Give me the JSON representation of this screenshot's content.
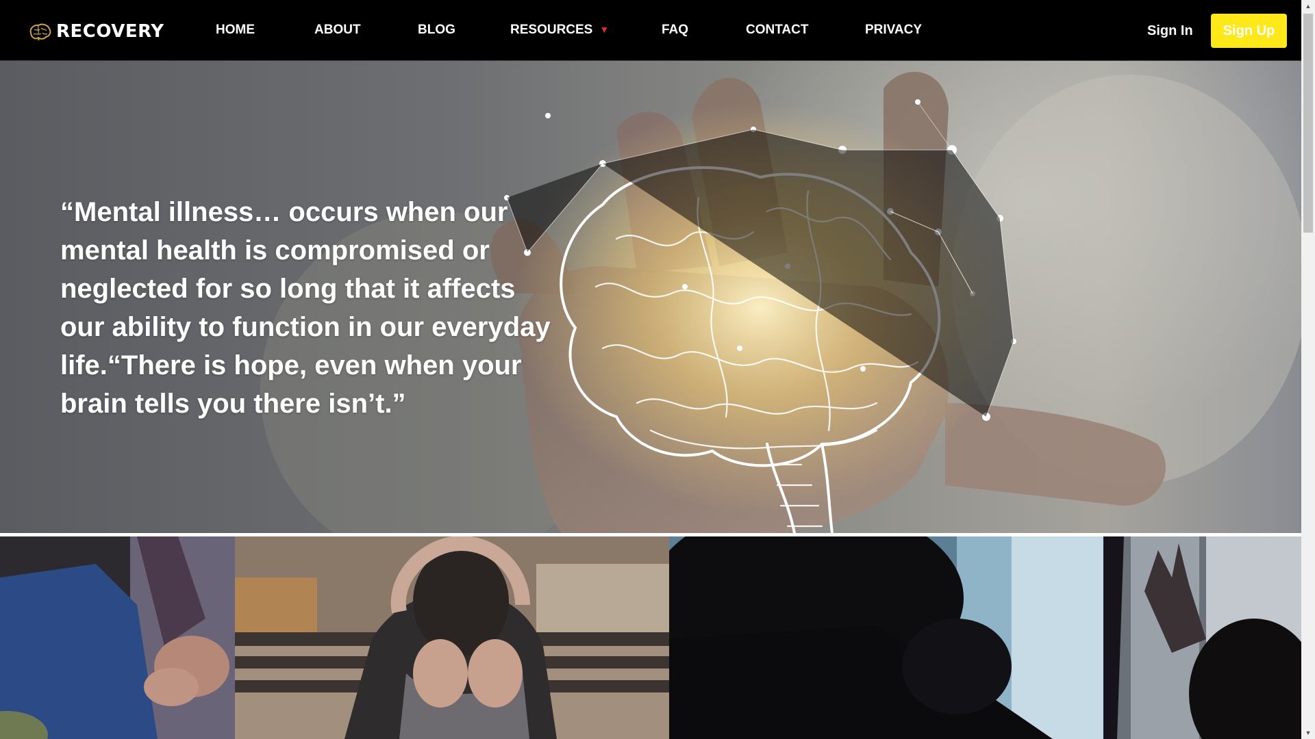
{
  "brand": {
    "name": "RECOVERY",
    "logo_icon": "brain-icon",
    "logo_color": "#c9a44a"
  },
  "nav": {
    "links": [
      {
        "label": "HOME"
      },
      {
        "label": "ABOUT"
      },
      {
        "label": "BLOG"
      },
      {
        "label": "RESOURCES",
        "caret": "▼"
      },
      {
        "label": "FAQ"
      },
      {
        "label": "CONTACT"
      },
      {
        "label": "PRIVACY"
      }
    ],
    "sign_in": "Sign In",
    "sign_up": "Sign Up"
  },
  "hero": {
    "quote": "“Mental illness… occurs when our mental health is compromised or neglected for so long that it affects our ability to function in our everyday life.“There is hope, even when your brain tells you there isn’t.”",
    "image": "glowing-brain-in-hand"
  },
  "photos": [
    {
      "subject": "clasped-hands"
    },
    {
      "subject": "person-head-in-hands-on-bench"
    },
    {
      "subject": "silhouette-person-distressed"
    },
    {
      "subject": "silhouette-hand-on-wall"
    }
  ],
  "colors": {
    "nav_bg": "#000000",
    "accent": "#ffe81a",
    "caret": "#e62a2a",
    "text": "#ffffff"
  }
}
